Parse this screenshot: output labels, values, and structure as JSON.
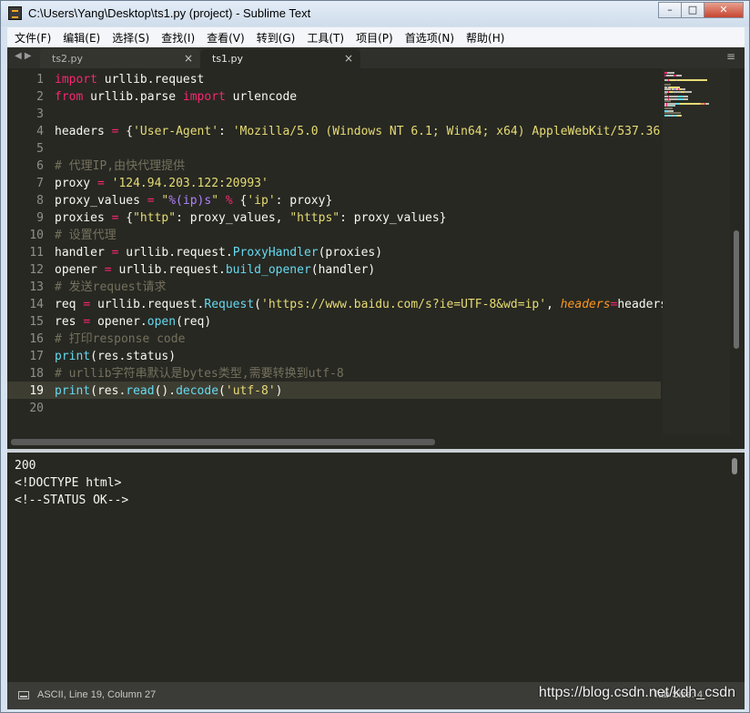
{
  "window": {
    "title": "C:\\Users\\Yang\\Desktop\\ts1.py (project) - Sublime Text",
    "buttons": {
      "minimize": "–",
      "maximize": "□",
      "close": "✕"
    }
  },
  "menu": [
    "文件(F)",
    "编辑(E)",
    "选择(S)",
    "查找(I)",
    "查看(V)",
    "转到(G)",
    "工具(T)",
    "项目(P)",
    "首选项(N)",
    "帮助(H)"
  ],
  "tabs": {
    "nav": "◀ ▶",
    "items": [
      {
        "label": "ts2.py",
        "close": "×",
        "active": false
      },
      {
        "label": "ts1.py",
        "close": "×",
        "active": true
      }
    ],
    "menu_icon": "≡"
  },
  "editor": {
    "current_line": 19,
    "line_numbers": [
      "1",
      "2",
      "3",
      "4",
      "5",
      "6",
      "7",
      "8",
      "9",
      "10",
      "11",
      "12",
      "13",
      "14",
      "15",
      "16",
      "17",
      "18",
      "19",
      "20"
    ],
    "lines": [
      [
        {
          "t": "import",
          "c": "kw"
        },
        {
          "t": " urllib.request"
        }
      ],
      [
        {
          "t": "from",
          "c": "kw"
        },
        {
          "t": " urllib.parse "
        },
        {
          "t": "import",
          "c": "kw"
        },
        {
          "t": " urlencode"
        }
      ],
      [],
      [
        {
          "t": "headers "
        },
        {
          "t": "=",
          "c": "op"
        },
        {
          "t": " {"
        },
        {
          "t": "'User-Agent'",
          "c": "str"
        },
        {
          "t": ": "
        },
        {
          "t": "'Mozilla/5.0 (Windows NT 6.1; Win64; x64) AppleWebKit/537.36",
          "c": "str"
        }
      ],
      [],
      [
        {
          "t": "# 代理IP,由快代理提供",
          "c": "cm"
        }
      ],
      [
        {
          "t": "proxy "
        },
        {
          "t": "=",
          "c": "op"
        },
        {
          "t": " "
        },
        {
          "t": "'124.94.203.122:20993'",
          "c": "str"
        }
      ],
      [
        {
          "t": "proxy_values "
        },
        {
          "t": "=",
          "c": "op"
        },
        {
          "t": " "
        },
        {
          "t": "\"",
          "c": "str"
        },
        {
          "t": "%(ip)s",
          "c": "num"
        },
        {
          "t": "\"",
          "c": "str"
        },
        {
          "t": " "
        },
        {
          "t": "%",
          "c": "op"
        },
        {
          "t": " {"
        },
        {
          "t": "'ip'",
          "c": "str"
        },
        {
          "t": ": proxy}"
        }
      ],
      [
        {
          "t": "proxies "
        },
        {
          "t": "=",
          "c": "op"
        },
        {
          "t": " {"
        },
        {
          "t": "\"http\"",
          "c": "str"
        },
        {
          "t": ": proxy_values, "
        },
        {
          "t": "\"https\"",
          "c": "str"
        },
        {
          "t": ": proxy_values}"
        }
      ],
      [
        {
          "t": "# 设置代理",
          "c": "cm"
        }
      ],
      [
        {
          "t": "handler "
        },
        {
          "t": "=",
          "c": "op"
        },
        {
          "t": " urllib.request."
        },
        {
          "t": "ProxyHandler",
          "c": "fn"
        },
        {
          "t": "(proxies)"
        }
      ],
      [
        {
          "t": "opener "
        },
        {
          "t": "=",
          "c": "op"
        },
        {
          "t": " urllib.request."
        },
        {
          "t": "build_opener",
          "c": "fn"
        },
        {
          "t": "(handler)"
        }
      ],
      [
        {
          "t": "# 发送request请求",
          "c": "cm"
        }
      ],
      [
        {
          "t": "req "
        },
        {
          "t": "=",
          "c": "op"
        },
        {
          "t": " urllib.request."
        },
        {
          "t": "Request",
          "c": "fn"
        },
        {
          "t": "("
        },
        {
          "t": "'https://www.baidu.com/s?ie=UTF-8&wd=ip'",
          "c": "str"
        },
        {
          "t": ", "
        },
        {
          "t": "headers",
          "c": "param"
        },
        {
          "t": "=",
          "c": "op"
        },
        {
          "t": "headers)"
        }
      ],
      [
        {
          "t": "res "
        },
        {
          "t": "=",
          "c": "op"
        },
        {
          "t": " opener."
        },
        {
          "t": "open",
          "c": "fn"
        },
        {
          "t": "(req)"
        }
      ],
      [
        {
          "t": "# 打印response code",
          "c": "cm"
        }
      ],
      [
        {
          "t": "print",
          "c": "fn"
        },
        {
          "t": "(res.status)"
        }
      ],
      [
        {
          "t": "# urllib字符串默认是bytes类型,需要转换到utf-8",
          "c": "cm"
        }
      ],
      [
        {
          "t": "print",
          "c": "fn"
        },
        {
          "t": "(res."
        },
        {
          "t": "read",
          "c": "fn"
        },
        {
          "t": "()."
        },
        {
          "t": "decode",
          "c": "fn"
        },
        {
          "t": "("
        },
        {
          "t": "'utf-8'",
          "c": "str"
        },
        {
          "t": ")"
        }
      ],
      []
    ]
  },
  "console": {
    "lines": [
      "200",
      "<!DOCTYPE html>",
      "<!--STATUS OK-->"
    ]
  },
  "status": {
    "position": "ASCII, Line 19, Column 27",
    "tab_size": "Tab Size: 4",
    "watermark": "https://blog.csdn.net/kdh_csdn"
  },
  "colors": {
    "editor_bg": "#272822",
    "keyword": "#f92672",
    "string": "#e6db74",
    "function": "#66d9ef",
    "comment": "#75715e"
  }
}
